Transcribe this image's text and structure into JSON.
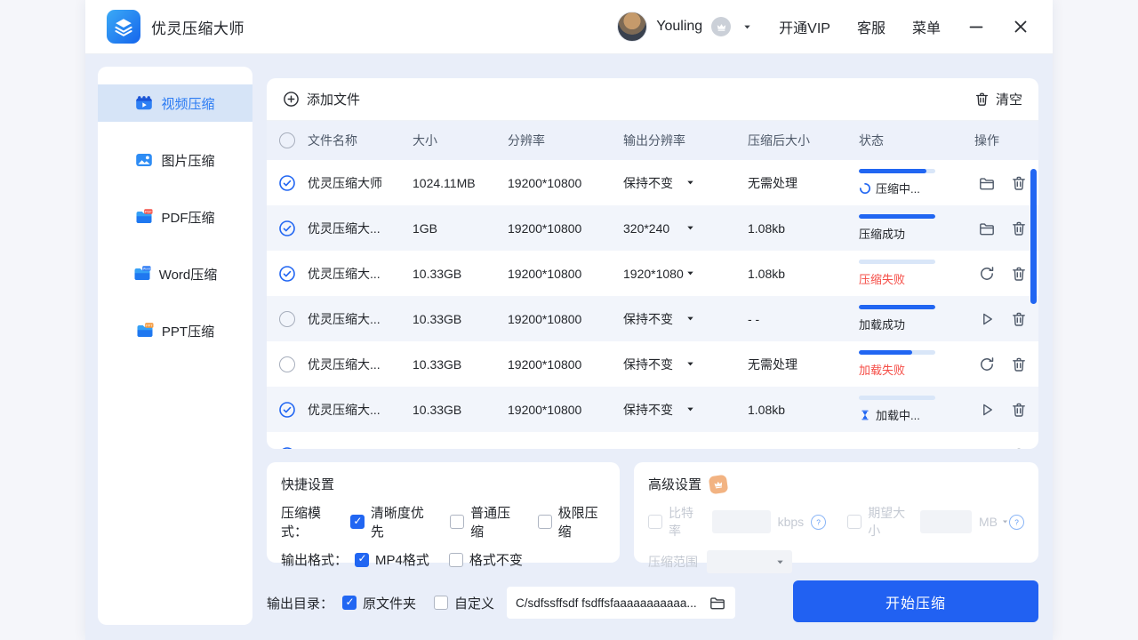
{
  "window": {
    "app_title": "优灵压缩大师",
    "logo_icon": "layers-icon",
    "user_name": "Youling",
    "user_badge_icon": "crown-icon",
    "dropdown_icon": "caret-down-icon",
    "nav": {
      "vip": "开通VIP",
      "support": "客服",
      "menu": "菜单"
    },
    "minimize_icon": "minimize-icon",
    "close_icon": "close-icon"
  },
  "sidebar": {
    "items": [
      {
        "label": "视频压缩",
        "icon": "video-compress-icon",
        "symbol": "si-video",
        "active": true
      },
      {
        "label": "图片压缩",
        "icon": "image-compress-icon",
        "symbol": "si-image",
        "active": false
      },
      {
        "label": "PDF压缩",
        "icon": "pdf-compress-icon",
        "symbol": "si-pdf",
        "active": false
      },
      {
        "label": "Word压缩",
        "icon": "word-compress-icon",
        "symbol": "si-word",
        "active": false
      },
      {
        "label": "PPT压缩",
        "icon": "ppt-compress-icon",
        "symbol": "si-ppt",
        "active": false
      }
    ]
  },
  "toolbar": {
    "add_label": "添加文件",
    "add_icon": "plus-circle-icon",
    "clear_label": "清空",
    "clear_icon": "trash-icon"
  },
  "table": {
    "headers": {
      "name": "文件名称",
      "size": "大小",
      "resolution": "分辨率",
      "output_resolution": "输出分辨率",
      "compressed_size": "压缩后大小",
      "status": "状态",
      "actions": "操作"
    },
    "rows": [
      {
        "checked": true,
        "name": "优灵压缩大师",
        "size": "1024.11MB",
        "resolution": "19200*10800",
        "output_resolution": "保持不变",
        "compressed_size": "无需处理",
        "status": "压缩中...",
        "status_type": "compressing",
        "progress": 88,
        "actions": [
          "open-folder",
          "delete"
        ]
      },
      {
        "checked": true,
        "name": "优灵压缩大...",
        "size": "1GB",
        "resolution": "19200*10800",
        "output_resolution": "320*240",
        "compressed_size": "1.08kb",
        "status": "压缩成功",
        "status_type": "success",
        "progress": 100,
        "actions": [
          "open-folder",
          "delete"
        ]
      },
      {
        "checked": true,
        "name": "优灵压缩大...",
        "size": "10.33GB",
        "resolution": "19200*10800",
        "output_resolution": "1920*1080",
        "compressed_size": "1.08kb",
        "status": "压缩失败",
        "status_type": "fail",
        "progress": 0,
        "actions": [
          "retry",
          "delete"
        ]
      },
      {
        "checked": false,
        "name": "优灵压缩大...",
        "size": "10.33GB",
        "resolution": "19200*10800",
        "output_resolution": "保持不变",
        "compressed_size": "- -",
        "status": "加载成功",
        "status_type": "success",
        "progress": 100,
        "actions": [
          "play",
          "delete"
        ]
      },
      {
        "checked": false,
        "name": "优灵压缩大...",
        "size": "10.33GB",
        "resolution": "19200*10800",
        "output_resolution": "保持不变",
        "compressed_size": "无需处理",
        "status": "加载失败",
        "status_type": "fail",
        "progress": 70,
        "actions": [
          "retry",
          "delete"
        ]
      },
      {
        "checked": true,
        "name": "优灵压缩大...",
        "size": "10.33GB",
        "resolution": "19200*10800",
        "output_resolution": "保持不变",
        "compressed_size": "1.08kb",
        "status": "加载中...",
        "status_type": "loading",
        "progress": 0,
        "actions": [
          "play",
          "delete"
        ]
      },
      {
        "checked": true,
        "name": "",
        "size": "",
        "resolution": "",
        "output_resolution": "",
        "compressed_size": "",
        "status": "",
        "status_type": "none",
        "progress": 0,
        "actions": [
          "open-folder",
          "delete"
        ]
      }
    ]
  },
  "quick_settings": {
    "title": "快捷设置",
    "rows": [
      {
        "label": "压缩模式：",
        "options": [
          {
            "label": "清晰度优先",
            "checked": true
          },
          {
            "label": "普通压缩",
            "checked": false
          },
          {
            "label": "极限压缩",
            "checked": false
          }
        ]
      },
      {
        "label": "输出格式：",
        "options": [
          {
            "label": "MP4格式",
            "checked": true
          },
          {
            "label": "格式不变",
            "checked": false
          }
        ]
      }
    ]
  },
  "advanced_settings": {
    "title": "高级设置",
    "vip_icon": "crown-icon",
    "bitrate": {
      "checked": false,
      "label": "比特率",
      "value": "",
      "unit": "kbps",
      "help_icon": "question-icon"
    },
    "expected_size": {
      "checked": false,
      "label": "期望大小",
      "value": "",
      "unit": "MB",
      "help_icon": "question-icon"
    },
    "range_label": "压缩范围",
    "range_value": ""
  },
  "output": {
    "label": "输出目录：",
    "options": [
      {
        "label": "原文件夹",
        "checked": true
      },
      {
        "label": "自定义",
        "checked": false
      }
    ],
    "path": "C/sdfssffsdf fsdffsfaaaaaaaaaaa...",
    "browse_icon": "folder-icon"
  },
  "start_button": "开始压缩",
  "colors": {
    "primary": "#2166F2",
    "danger": "#F54C45",
    "body_bg": "#E9EEF9",
    "active_item_bg": "#D6E4F7",
    "progress_track": "#D9E6F8"
  }
}
